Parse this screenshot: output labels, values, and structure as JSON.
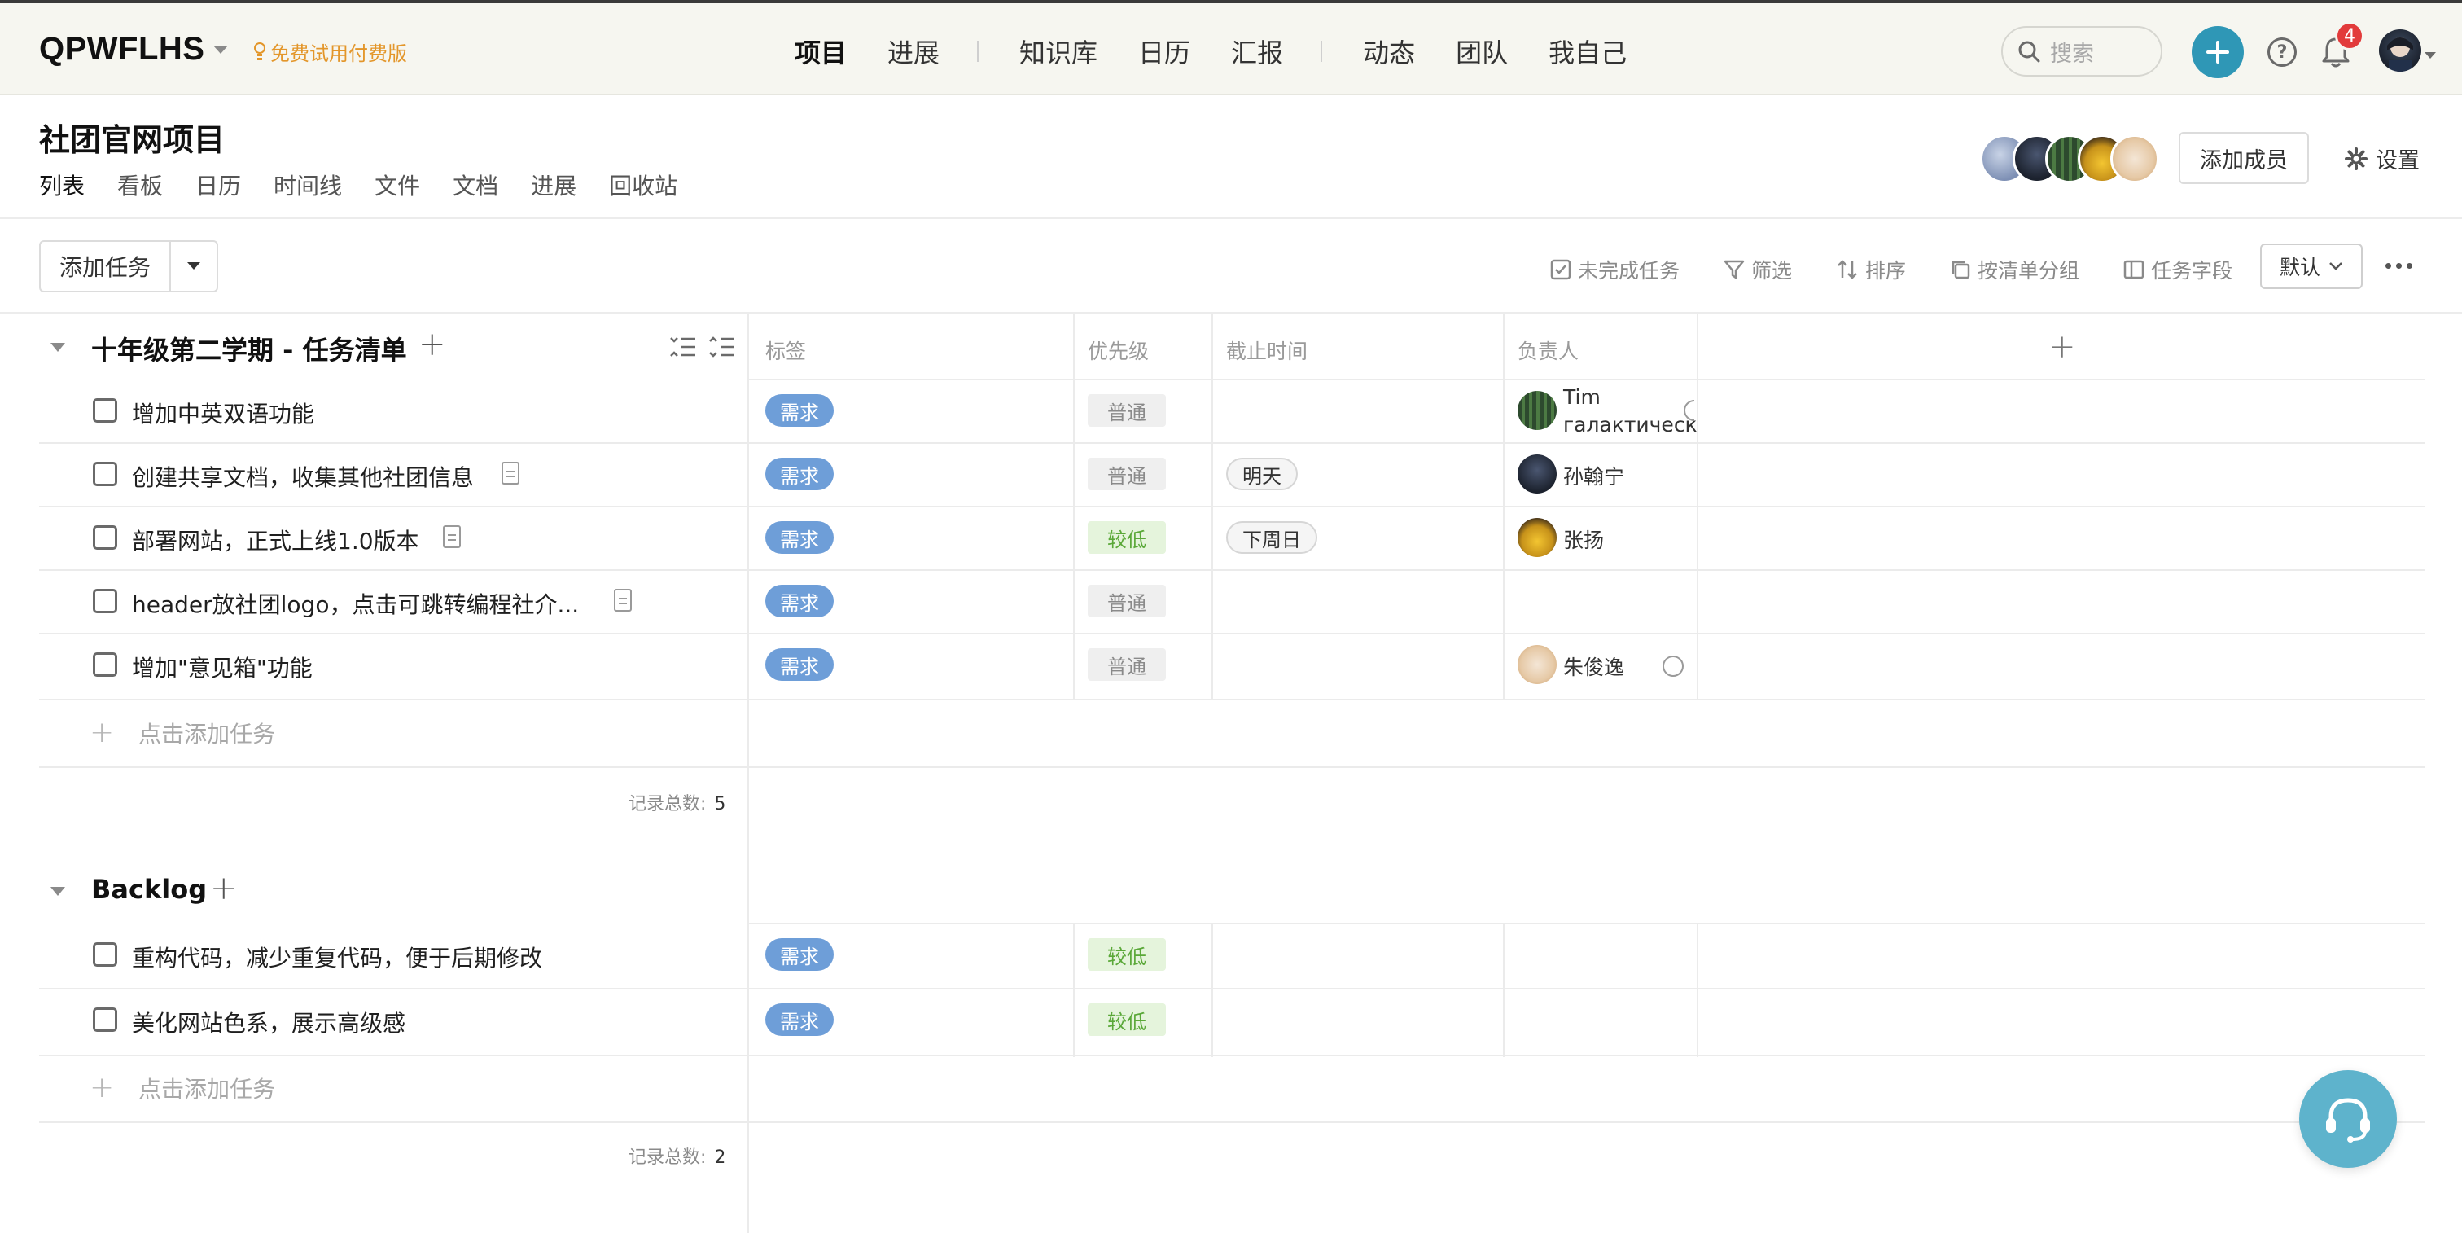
{
  "topbar": {
    "brand": "QPWFLHS",
    "trial": "免费试用付费版",
    "nav": [
      "项目",
      "进展",
      "知识库",
      "日历",
      "汇报",
      "动态",
      "团队",
      "我自己"
    ],
    "search_placeholder": "搜索",
    "notification_count": "4"
  },
  "project": {
    "title": "社团官网项目",
    "tabs": [
      "列表",
      "看板",
      "日历",
      "时间线",
      "文件",
      "文档",
      "进展",
      "回收站"
    ],
    "add_member": "添加成员",
    "settings": "设置"
  },
  "toolbar": {
    "add_task": "添加任务",
    "tools": [
      "未完成任务",
      "筛选",
      "排序",
      "按清单分组",
      "任务字段"
    ],
    "default": "默认"
  },
  "columns": {
    "tag": "标签",
    "priority": "优先级",
    "due": "截止时间",
    "assignee": "负责人"
  },
  "groups": [
    {
      "title": "十年级第二学期 - 任务清单",
      "tasks": [
        {
          "name": "增加中英双语功能",
          "tag": "需求",
          "priority": "普通",
          "due": "",
          "assignee_line1": "Tim",
          "assignee_line2": "галактическ"
        },
        {
          "name": "创建共享文档，收集其他社团信息",
          "tag": "需求",
          "priority": "普通",
          "due": "明天",
          "assignee": "孙翰宁"
        },
        {
          "name": "部署网站，正式上线1.0版本",
          "tag": "需求",
          "priority": "较低",
          "due": "下周日",
          "assignee": "张扬"
        },
        {
          "name": "header放社团logo，点击可跳转编程社介...",
          "tag": "需求",
          "priority": "普通",
          "due": "",
          "assignee": ""
        },
        {
          "name": "增加\"意见箱\"功能",
          "tag": "需求",
          "priority": "普通",
          "due": "",
          "assignee": "朱俊逸"
        }
      ],
      "add_task": "点击添加任务",
      "count_label": "记录总数:",
      "count": "5"
    },
    {
      "title": "Backlog",
      "tasks": [
        {
          "name": "重构代码，减少重复代码，便于后期修改",
          "tag": "需求",
          "priority": "较低"
        },
        {
          "name": "美化网站色系，展示高级感",
          "tag": "需求",
          "priority": "较低"
        }
      ],
      "add_task": "点击添加任务",
      "count_label": "记录总数:",
      "count": "2"
    }
  ],
  "colors": {
    "accent": "#2f97b6",
    "tag_blue": "#6e9ed8",
    "low_priority": "#5aa838",
    "trial_orange": "#e3962a",
    "badge_red": "#e23b3b"
  }
}
